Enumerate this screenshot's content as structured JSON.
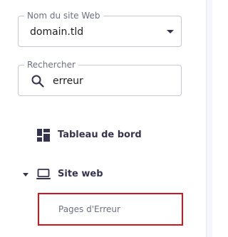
{
  "website_select": {
    "label": "Nom du site Web",
    "value": "domain.tld"
  },
  "search": {
    "label": "Rechercher",
    "value": "erreur",
    "icon": "search-icon"
  },
  "nav": {
    "dashboard": {
      "label": "Tableau de bord",
      "icon": "dashboard-grid-icon"
    },
    "website": {
      "label": "Site web",
      "icon": "laptop-icon",
      "expanded": true
    },
    "website_children": [
      {
        "label": "Pages d'Erreur",
        "highlighted": true
      }
    ]
  },
  "colors": {
    "highlight_border": "#d1161b",
    "text_primary": "#36344d",
    "text_muted": "#6d7081"
  }
}
